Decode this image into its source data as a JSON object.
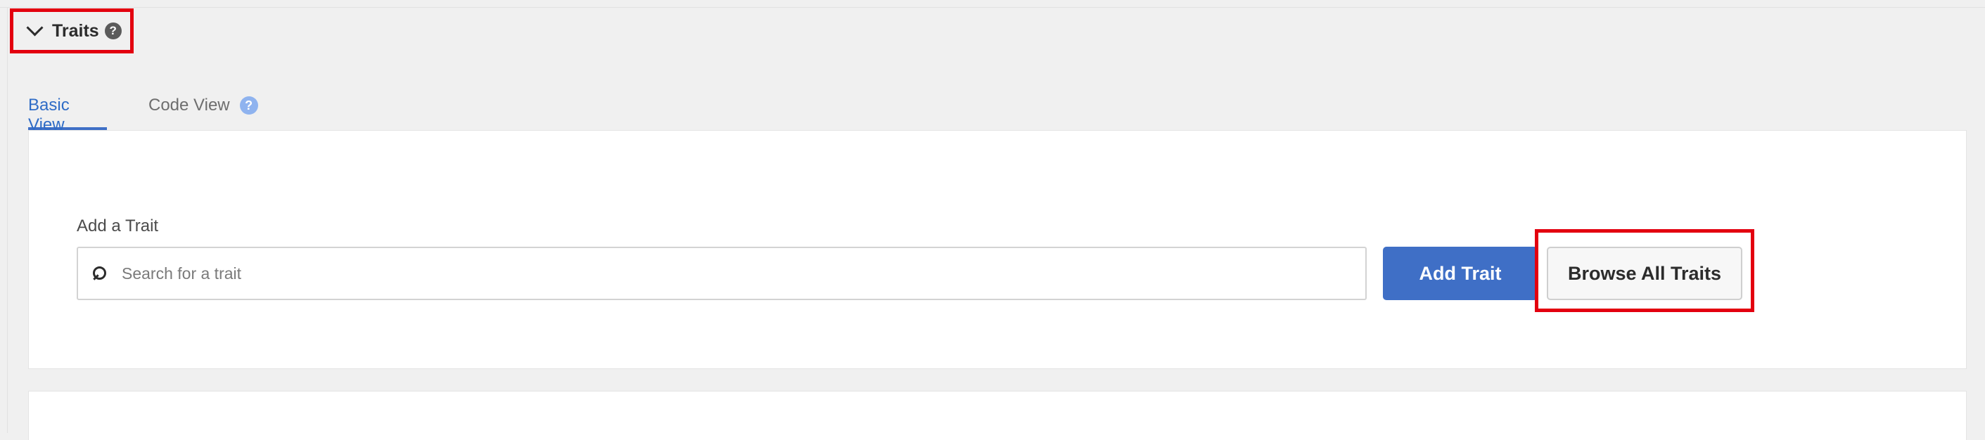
{
  "section": {
    "title": "Traits",
    "help_icon": "?"
  },
  "tabs": [
    {
      "label": "Basic View",
      "active": true
    },
    {
      "label": "Code View",
      "active": false,
      "help_icon": "?"
    }
  ],
  "form": {
    "label": "Add a Trait",
    "search": {
      "placeholder": "Search for a trait",
      "value": ""
    },
    "add_button": "Add Trait",
    "browse_button": "Browse All Traits"
  },
  "colors": {
    "accent": "#3f6fc6",
    "highlight_frame": "#e3000f",
    "background": "#f0f0f0",
    "panel": "#ffffff"
  },
  "icons": {
    "collapse": "chevron-down-icon",
    "help": "help-circle-icon",
    "search": "search-icon"
  }
}
